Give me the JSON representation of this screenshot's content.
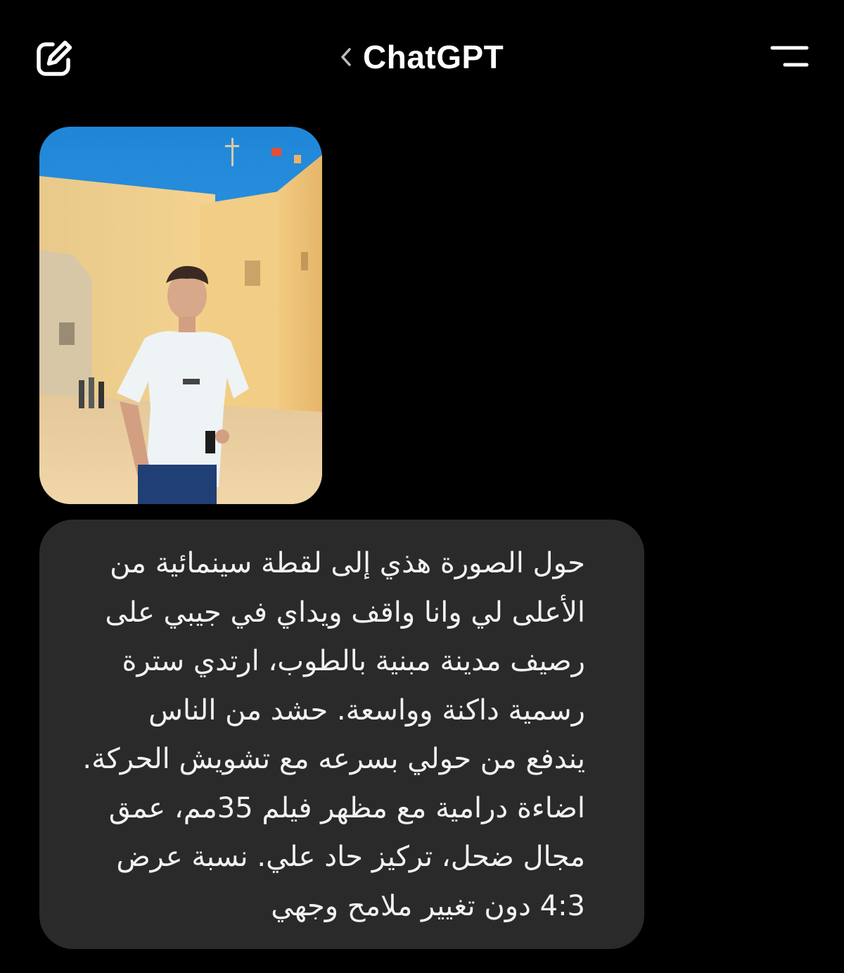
{
  "header": {
    "title": "ChatGPT",
    "icons": {
      "new_chat": "edit-square-icon",
      "back": "chevron-left-icon",
      "menu": "menu-lines-icon"
    }
  },
  "conversation": {
    "attachment": {
      "type": "image"
    },
    "user_message": {
      "text": "حول الصورة هذي إلى لقطة سينمائية من\nالأعلى لي وانا واقف ويداي في جيبي على\nرصيف مدينة مبنية بالطوب، ارتدي سترة\nرسمية داكنة وواسعة. حشد من الناس\nيندفع من حولي بسرعه مع تشويش الحركة.\nاضاءة درامية مع مظهر فيلم 35مم، عمق\nمجال ضحل، تركيز حاد علي. نسبة عرض\n4:3 دون تغيير ملامح وجهي"
    }
  },
  "colors": {
    "background": "#000000",
    "bubble": "#2a2a2a",
    "text": "#f2f2f2"
  }
}
